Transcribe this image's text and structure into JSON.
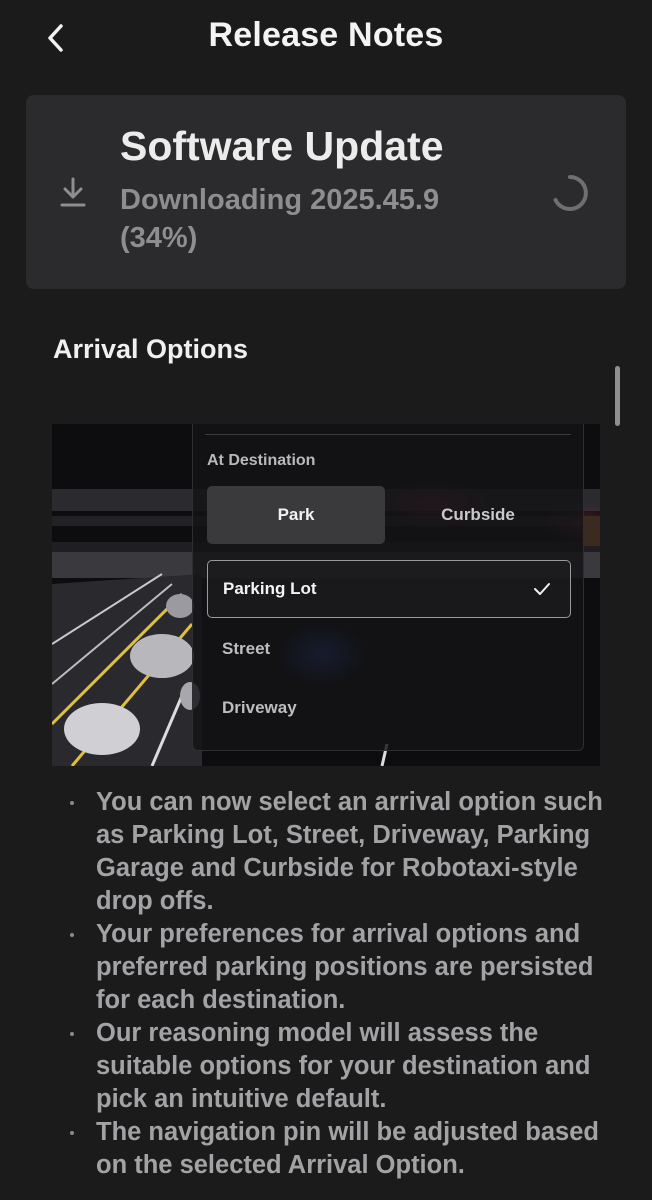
{
  "header": {
    "title": "Release Notes",
    "back_icon": "chevron-left-icon"
  },
  "update": {
    "title": "Software Update",
    "status": "Downloading 2025.45.9 (34%)",
    "progress_percent": 34,
    "download_icon": "download-icon",
    "spinner_icon": "loading-spinner-icon"
  },
  "section": {
    "title": "Arrival Options"
  },
  "preview": {
    "panel_label": "At Destination",
    "segments": [
      {
        "label": "Park",
        "selected": true
      },
      {
        "label": "Curbside",
        "selected": false
      }
    ],
    "options": [
      {
        "label": "Parking Lot",
        "selected": true
      },
      {
        "label": "Street",
        "selected": false
      },
      {
        "label": "Driveway",
        "selected": false
      }
    ],
    "check_icon": "checkmark-icon"
  },
  "notes": [
    "You can now select an arrival option such as Parking Lot, Street, Driveway, Parking Garage and Curbside for Robotaxi-style drop offs.",
    "Your preferences for arrival options and preferred parking positions are persisted for each destination.",
    "Our reasoning model will assess the suitable options for your destination and pick an intuitive default.",
    "The navigation pin will be adjusted based on the selected Arrival Option."
  ],
  "colors": {
    "background": "#1b1b1c",
    "card": "#2b2b2d",
    "muted_text": "#8e8e90"
  }
}
